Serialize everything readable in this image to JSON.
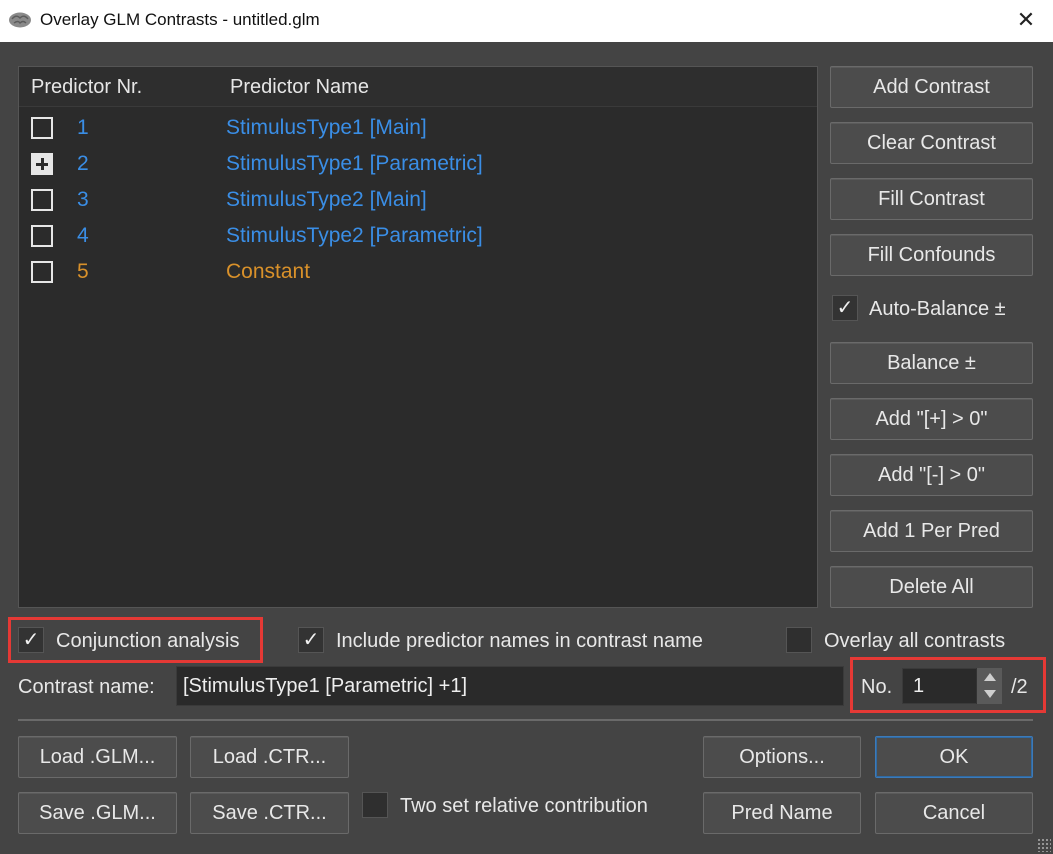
{
  "window": {
    "title": "Overlay GLM Contrasts - untitled.glm",
    "close_glyph": "✕",
    "app_icon": "brain-icon"
  },
  "list": {
    "headers": {
      "nr": "Predictor Nr.",
      "name": "Predictor Name"
    },
    "rows": [
      {
        "nr": "1",
        "name": "StimulusType1 [Main]",
        "state": "unchecked",
        "color": "#3a8ee6"
      },
      {
        "nr": "2",
        "name": "StimulusType1 [Parametric]",
        "state": "plus",
        "color": "#3a8ee6"
      },
      {
        "nr": "3",
        "name": "StimulusType2 [Main]",
        "state": "unchecked",
        "color": "#3a8ee6"
      },
      {
        "nr": "4",
        "name": "StimulusType2 [Parametric]",
        "state": "unchecked",
        "color": "#3a8ee6"
      },
      {
        "nr": "5",
        "name": "Constant",
        "state": "unchecked",
        "color": "#d9912a"
      }
    ]
  },
  "side": {
    "add_contrast": "Add Contrast",
    "clear_contrast": "Clear Contrast",
    "fill_contrast": "Fill Contrast",
    "fill_confounds": "Fill Confounds",
    "auto_balance": {
      "label": "Auto-Balance ±",
      "checked": true
    },
    "balance": "Balance ±",
    "add_plus": "Add \"[+] > 0\"",
    "add_minus": "Add \"[-]  > 0\"",
    "add_per_pred": "Add 1 Per Pred",
    "delete_all": "Delete All"
  },
  "options": {
    "conjunction": {
      "label": "Conjunction analysis",
      "checked": true
    },
    "include_names": {
      "label": "Include predictor names in contrast name",
      "checked": true
    },
    "overlay_all": {
      "label": "Overlay all contrasts",
      "checked": false
    },
    "check_glyph": "✓"
  },
  "contrast": {
    "name_label": "Contrast name:",
    "name_value": "[StimulusType1 [Parametric] +1]",
    "no_label": "No.",
    "no_value": "1",
    "total": "/2"
  },
  "bottom": {
    "load_glm": "Load .GLM...",
    "load_ctr": "Load .CTR...",
    "save_glm": "Save .GLM...",
    "save_ctr": "Save .CTR...",
    "two_set": {
      "label": "Two set relative contribution",
      "checked": false
    },
    "options": "Options...",
    "pred_name": "Pred  Name",
    "ok": "OK",
    "cancel": "Cancel"
  },
  "colors": {
    "predictor_blue": "#3a8ee6",
    "predictor_orange": "#d9912a",
    "highlight_red": "#e53935",
    "ok_border": "#3d7ab8"
  }
}
